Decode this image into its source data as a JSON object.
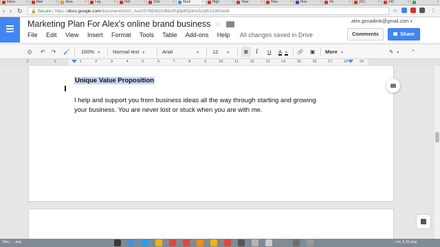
{
  "browser": {
    "tabs": [
      {
        "label": "Inbox",
        "color": "#d93025"
      },
      {
        "label": "Mail",
        "color": "#d93025"
      },
      {
        "label": "Ama",
        "color": "#ff9900"
      },
      {
        "label": "Log",
        "color": "#d93025"
      },
      {
        "label": "Onli",
        "color": "#d93025"
      },
      {
        "label": "Onli",
        "color": "#d93025"
      },
      {
        "label": "Mark",
        "color": "#4285f4"
      },
      {
        "label": "High",
        "color": "#d93025"
      },
      {
        "label": "How",
        "color": "#d93025"
      },
      {
        "label": "How",
        "color": "#d93025"
      },
      {
        "label": "How",
        "color": "#4b3fb5"
      },
      {
        "label": "Fb",
        "color": "#d93025"
      },
      {
        "label": "(41)",
        "color": "#d93025"
      },
      {
        "label": "142",
        "color": "#d93025"
      },
      {
        "label": "",
        "color": "#34a853"
      }
    ],
    "secure_label": "Secure",
    "url_prefix": "https://",
    "url_host": "docs.google.com",
    "url_path": "/document/d/1G_Aurlz579lDfdztU8bctRglIpltfQdms5zzjl013260/edit"
  },
  "docs": {
    "title": "Marketing Plan For Alex's online brand business",
    "menu": [
      "File",
      "Edit",
      "View",
      "Insert",
      "Format",
      "Tools",
      "Table",
      "Add-ons",
      "Help"
    ],
    "saved_status": "All changes saved in Drive",
    "account_email": "alex.genadinik@gmail.com",
    "comments_label": "Comments",
    "share_label": "Share"
  },
  "toolbar": {
    "zoom": "100%",
    "style": "Normal text",
    "font": "Arial",
    "size": "12",
    "bold": "B",
    "italic": "I",
    "underline": "U",
    "text_color": "A",
    "more": "More"
  },
  "ruler": {
    "left_numbers": [
      "2",
      "1"
    ],
    "numbers": [
      "1",
      "2",
      "3",
      "4",
      "5",
      "6",
      "7",
      "8",
      "9",
      "10",
      "11",
      "12",
      "13",
      "14",
      "15",
      "16",
      "17",
      "18",
      "19"
    ]
  },
  "document": {
    "heading": "Unique Value Proposition",
    "line1": "I help and support you from business ideas all the way through starting and growing",
    "line2": "your business. You are never lost or stuck when you are with me."
  },
  "dock": {
    "left_label": "Res... ...png",
    "right_label": "...cm_ll_01.png"
  }
}
